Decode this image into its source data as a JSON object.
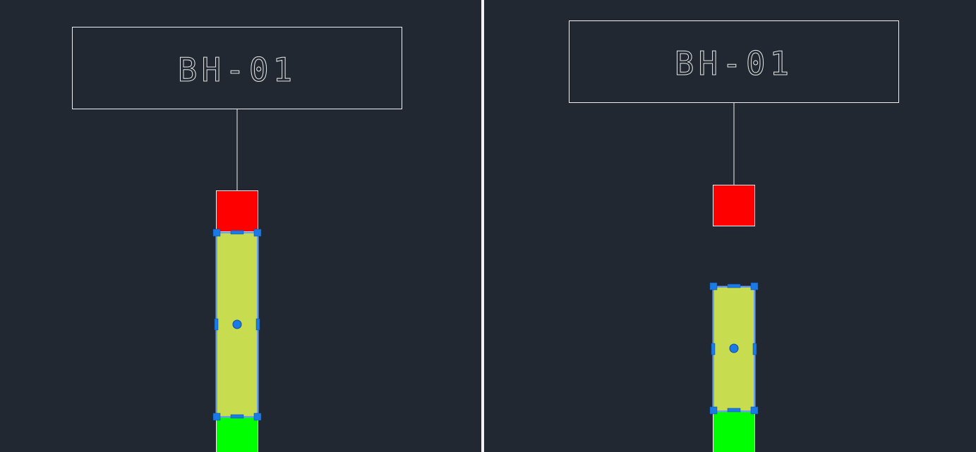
{
  "viewports": [
    {
      "label": "BH-01",
      "colors": {
        "background": "#222831",
        "outline": "#ffffff",
        "top_block": "#ff0000",
        "selected_block": "#c8dc50",
        "bottom_block": "#00ff00",
        "grip": "#1a7ae6"
      }
    },
    {
      "label": "BH-01",
      "colors": {
        "background": "#222831",
        "outline": "#ffffff",
        "top_block": "#ff0000",
        "selected_block": "#c8dc50",
        "bottom_block": "#00ff00",
        "grip": "#1a7ae6"
      }
    }
  ],
  "icons": {
    "grip": "square-grip-icon",
    "center_grip": "circle-grip-icon"
  }
}
